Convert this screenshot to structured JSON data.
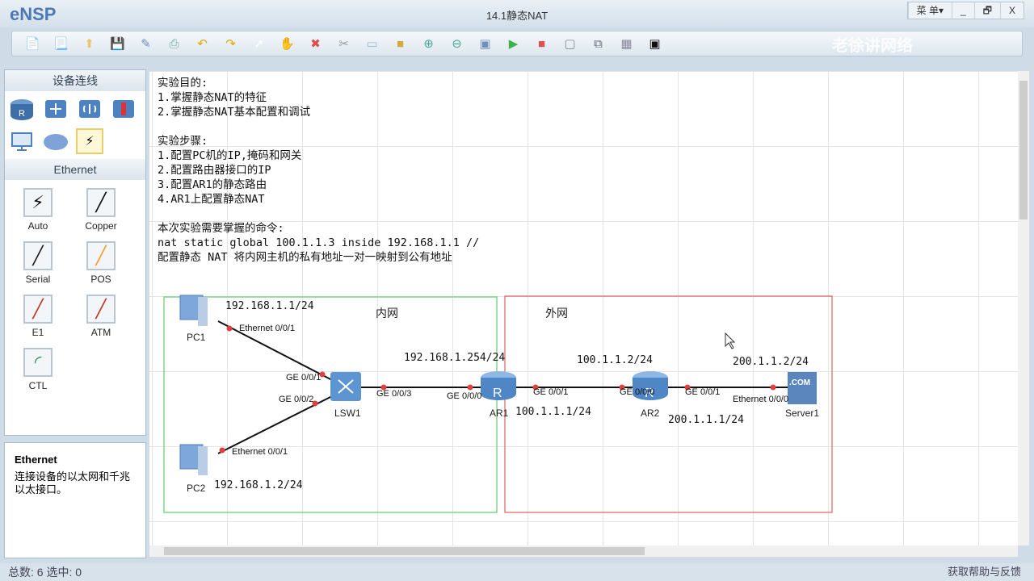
{
  "app": {
    "name": "eNSP",
    "title": "14.1静态NAT",
    "menu": "菜 单▾",
    "minimize": "_",
    "restore": "🗗",
    "close": "X",
    "watermark": "老徐讲网络"
  },
  "toolbar": [
    "new-topology",
    "new-script",
    "open",
    "save",
    "save-as",
    "print",
    "undo",
    "redo",
    "select",
    "pan",
    "delete",
    "delete-link",
    "text",
    "palette",
    "zoom-in",
    "zoom-out",
    "fit",
    "start",
    "stop",
    "capture",
    "topology",
    "grid",
    "console"
  ],
  "left": {
    "section_title": "设备连线",
    "cable_section": "Ethernet",
    "cables": [
      "Auto",
      "Copper",
      "Serial",
      "POS",
      "E1",
      "ATM",
      "CTL"
    ],
    "desc_title": "Ethernet",
    "desc_text": "连接设备的以太网和千兆以太接口。"
  },
  "notes": {
    "text": "实验目的:\n1.掌握静态NAT的特征\n2.掌握静态NAT基本配置和调试\n\n实验步骤:\n1.配置PC机的IP,掩码和网关\n2.配置路由器接口的IP\n3.配置AR1的静态路由\n4.AR1上配置静态NAT\n\n本次实验需要掌握的命令:\nnat static global 100.1.1.3 inside 192.168.1.1 //\n配置静态 NAT 将内网主机的私有地址一对一映射到公有地址"
  },
  "topology": {
    "zones": {
      "inner": "内网",
      "outer": "外网"
    },
    "devices": {
      "pc1": "PC1",
      "pc2": "PC2",
      "lsw1": "LSW1",
      "ar1": "AR1",
      "ar2": "AR2",
      "server1": "Server1"
    },
    "ports": {
      "pc1_eth": "Ethernet 0/0/1",
      "pc2_eth": "Ethernet 0/0/1",
      "lsw_g1": "GE 0/0/1",
      "lsw_g2": "GE 0/0/2",
      "lsw_g3": "GE 0/0/3",
      "ar1_g0": "GE 0/0/0",
      "ar1_g1": "GE 0/0/1",
      "ar2_g0": "GE 0/0/0",
      "ar2_g1": "GE 0/0/1",
      "srv_eth": "Ethernet 0/0/0"
    },
    "ips": {
      "pc1": "192.168.1.1/24",
      "pc2": "192.168.1.2/24",
      "ar1_in": "192.168.1.254/24",
      "ar1_out": "100.1.1.1/24",
      "ar2_in": "100.1.1.2/24",
      "ar2_out": "200.1.1.1/24",
      "server": "200.1.1.2/24"
    }
  },
  "status": {
    "left": "总数: 6 选中: 0",
    "right": "获取帮助与反馈"
  },
  "colors": {
    "inner_zone": "#7ed48a",
    "outer_zone": "#e06060",
    "port_dot": "#e04040"
  }
}
